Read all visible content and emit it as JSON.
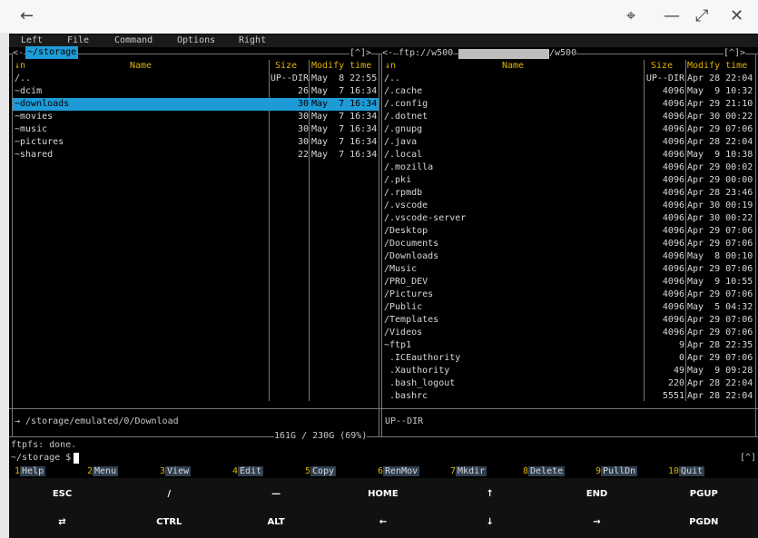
{
  "window": {
    "back_icon": "arrow-left-icon",
    "pin_icon": "pin-icon",
    "minimize_icon": "minimize-icon",
    "maximize_icon": "maximize-icon",
    "close_icon": "close-icon"
  },
  "menu": [
    "Left",
    "File",
    "Command",
    "Options",
    "Right"
  ],
  "left_panel": {
    "path": "~/storage",
    "corner": "[^]>",
    "col_sort": "↓n",
    "col_name": "Name",
    "col_size": "Size",
    "col_time": "Modify time",
    "rows": [
      {
        "name": "/..",
        "size": "UP--DIR",
        "time": "May  8 22:55"
      },
      {
        "name": "~dcim",
        "size": "26",
        "time": "May  7 16:34"
      },
      {
        "name": "~downloads",
        "size": "30",
        "time": "May  7 16:34"
      },
      {
        "name": "~movies",
        "size": "30",
        "time": "May  7 16:34"
      },
      {
        "name": "~music",
        "size": "30",
        "time": "May  7 16:34"
      },
      {
        "name": "~pictures",
        "size": "30",
        "time": "May  7 16:34"
      },
      {
        "name": "~shared",
        "size": "22",
        "time": "May  7 16:34"
      }
    ],
    "selected_index": 2,
    "status": "→ /storage/emulated/0/Download",
    "disk": "161G / 230G (69%)"
  },
  "right_panel": {
    "path_start": "ftp://w500",
    "path_end": "/w500",
    "corner": "[^]>",
    "col_sort": "↓n",
    "col_name": "Name",
    "col_size": "Size",
    "col_time": "Modify time",
    "rows": [
      {
        "name": "/..",
        "size": "UP--DIR",
        "time": "Apr 28 22:04"
      },
      {
        "name": "/.cache",
        "size": "4096",
        "time": "May  9 10:32"
      },
      {
        "name": "/.config",
        "size": "4096",
        "time": "Apr 29 21:10"
      },
      {
        "name": "/.dotnet",
        "size": "4096",
        "time": "Apr 30 00:22"
      },
      {
        "name": "/.gnupg",
        "size": "4096",
        "time": "Apr 29 07:06"
      },
      {
        "name": "/.java",
        "size": "4096",
        "time": "Apr 28 22:04"
      },
      {
        "name": "/.local",
        "size": "4096",
        "time": "May  9 10:38"
      },
      {
        "name": "/.mozilla",
        "size": "4096",
        "time": "Apr 29 00:02"
      },
      {
        "name": "/.pki",
        "size": "4096",
        "time": "Apr 29 00:00"
      },
      {
        "name": "/.rpmdb",
        "size": "4096",
        "time": "Apr 28 23:46"
      },
      {
        "name": "/.vscode",
        "size": "4096",
        "time": "Apr 30 00:19"
      },
      {
        "name": "/.vscode-server",
        "size": "4096",
        "time": "Apr 30 00:22"
      },
      {
        "name": "/Desktop",
        "size": "4096",
        "time": "Apr 29 07:06"
      },
      {
        "name": "/Documents",
        "size": "4096",
        "time": "Apr 29 07:06"
      },
      {
        "name": "/Downloads",
        "size": "4096",
        "time": "May  8 00:10"
      },
      {
        "name": "/Music",
        "size": "4096",
        "time": "Apr 29 07:06"
      },
      {
        "name": "/PRO_DEV",
        "size": "4096",
        "time": "May  9 10:55"
      },
      {
        "name": "/Pictures",
        "size": "4096",
        "time": "Apr 29 07:06"
      },
      {
        "name": "/Public",
        "size": "4096",
        "time": "May  5 04:32"
      },
      {
        "name": "/Templates",
        "size": "4096",
        "time": "Apr 29 07:06"
      },
      {
        "name": "/Videos",
        "size": "4096",
        "time": "Apr 29 07:06"
      },
      {
        "name": "~ftp1",
        "size": "9",
        "time": "Apr 28 22:35"
      },
      {
        "name": " .ICEauthority",
        "size": "0",
        "time": "Apr 29 07:06"
      },
      {
        "name": " .Xauthority",
        "size": "49",
        "time": "May  9 09:28"
      },
      {
        "name": " .bash_logout",
        "size": "220",
        "time": "Apr 28 22:04"
      },
      {
        "name": " .bashrc",
        "size": "5551",
        "time": "Apr 28 22:04"
      }
    ],
    "status": "UP--DIR"
  },
  "console": {
    "line1": "ftpfs: done.",
    "prompt": "~/storage $",
    "corner": "[^]"
  },
  "fkeys": [
    {
      "n": "1",
      "label": "Help"
    },
    {
      "n": "2",
      "label": "Menu"
    },
    {
      "n": "3",
      "label": "View"
    },
    {
      "n": "4",
      "label": "Edit"
    },
    {
      "n": "5",
      "label": "Copy"
    },
    {
      "n": "6",
      "label": "RenMov"
    },
    {
      "n": "7",
      "label": "Mkdir"
    },
    {
      "n": "8",
      "label": "Delete"
    },
    {
      "n": "9",
      "label": "PullDn"
    },
    {
      "n": "10",
      "label": "Quit"
    }
  ],
  "extra_keys": {
    "row1": [
      "ESC",
      "/",
      "—",
      "HOME",
      "↑",
      "END",
      "PGUP"
    ],
    "row2": [
      "⇄",
      "CTRL",
      "ALT",
      "←",
      "↓",
      "→",
      "PGDN"
    ]
  }
}
